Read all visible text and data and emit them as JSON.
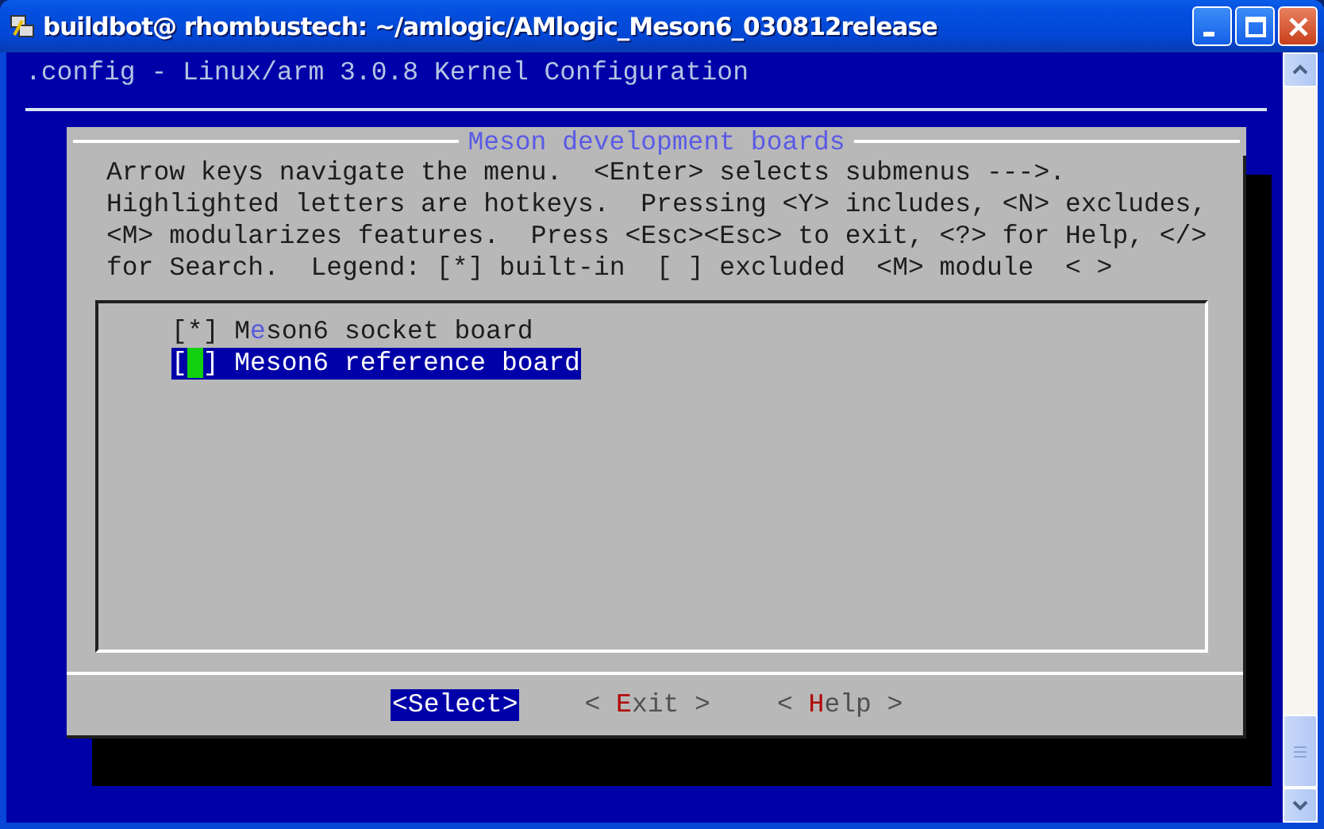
{
  "window": {
    "title": "buildbot@ rhombustech: ~/amlogic/AMlogic_Meson6_030812release"
  },
  "terminal": {
    "header": ".config - Linux/arm 3.0.8 Kernel Configuration",
    "dialog": {
      "title": "Meson development boards",
      "help_lines": [
        "Arrow keys navigate the menu.  <Enter> selects submenus --->.",
        "Highlighted letters are hotkeys.  Pressing <Y> includes, <N> excludes,",
        "<M> modularizes features.  Press <Esc><Esc> to exit, <?> for Help, </>",
        "for Search.  Legend: [*] built-in  [ ] excluded  <M> module  < >"
      ],
      "items": [
        {
          "box": "[*]",
          "before": "M",
          "hotkey": "e",
          "after": "son6 socket board",
          "selected": false
        },
        {
          "box": "[ ]",
          "after": "Meson6 reference board",
          "selected": true
        }
      ],
      "buttons": [
        {
          "before": "<",
          "hotkey": "S",
          "after": "elect>",
          "selected": true
        },
        {
          "before": "< ",
          "hotkey": "E",
          "after": "xit >",
          "selected": false
        },
        {
          "before": "< ",
          "hotkey": "H",
          "after": "elp >",
          "selected": false
        }
      ]
    }
  }
}
